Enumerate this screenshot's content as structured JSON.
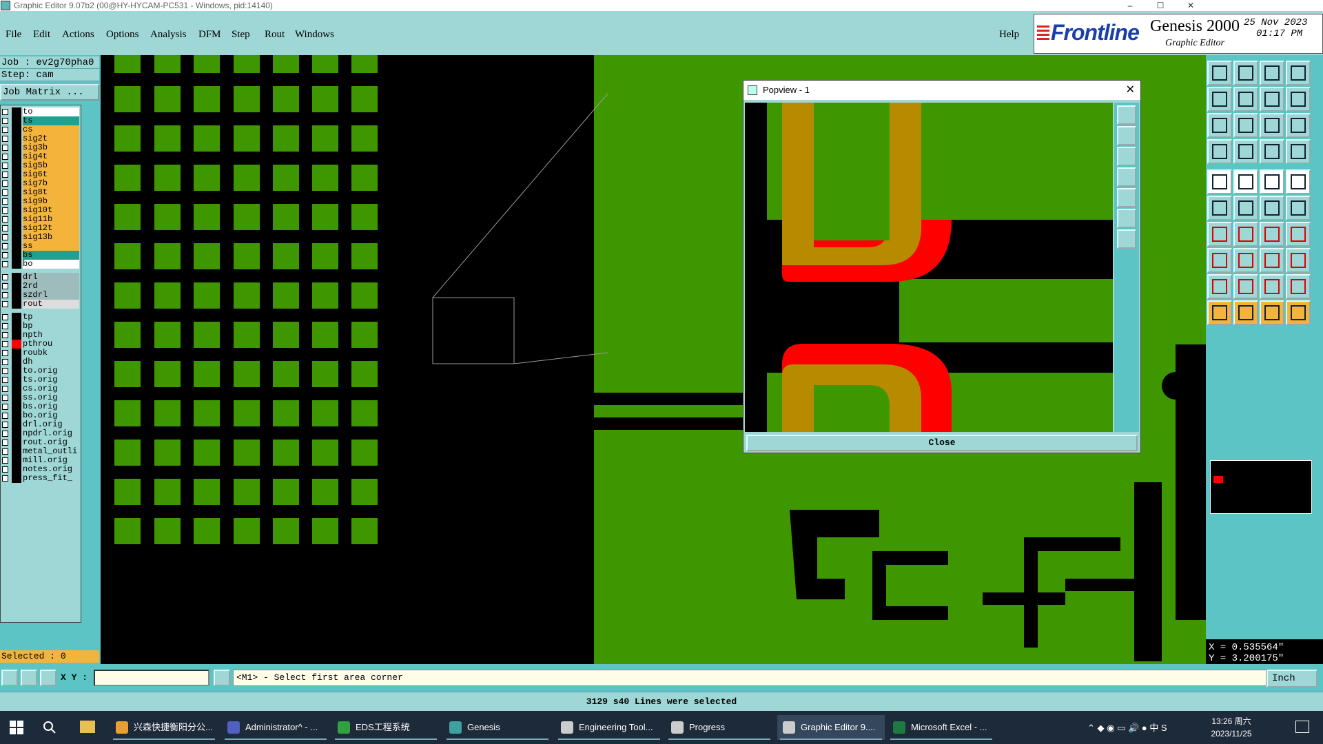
{
  "window": {
    "title": "Graphic Editor 9.07b2 (00@HY-HYCAM-PC531 - Windows, pid:14140)",
    "controls": [
      "–",
      "☐",
      "✕"
    ]
  },
  "menu": {
    "items": [
      "File",
      "Edit",
      "Actions",
      "Options",
      "Analysis",
      "DFM",
      "Step",
      "Rout",
      "Windows"
    ],
    "help": "Help"
  },
  "logo": {
    "brand": "Frontline",
    "product": "Genesis 2000",
    "subtitle": "Graphic Editor",
    "date": "25 Nov 2023",
    "time": "01:17 PM"
  },
  "job": {
    "job_line": "Job : ev2g70pha0",
    "step_line": "Step: cam",
    "matrix_button": "Job Matrix ...",
    "selected": "Selected : 0"
  },
  "layers": [
    {
      "name": "to",
      "color": "#ffffff"
    },
    {
      "name": "ts",
      "color": "#20a090"
    },
    {
      "name": "cs",
      "color": "#f4b43c"
    },
    {
      "name": "sig2t",
      "color": "#f4b43c"
    },
    {
      "name": "sig3b",
      "color": "#f4b43c"
    },
    {
      "name": "sig4t",
      "color": "#f4b43c"
    },
    {
      "name": "sig5b",
      "color": "#f4b43c"
    },
    {
      "name": "sig6t",
      "color": "#f4b43c"
    },
    {
      "name": "sig7b",
      "color": "#f4b43c"
    },
    {
      "name": "sig8t",
      "color": "#f4b43c"
    },
    {
      "name": "sig9b",
      "color": "#f4b43c"
    },
    {
      "name": "sig10t",
      "color": "#f4b43c"
    },
    {
      "name": "sig11b",
      "color": "#f4b43c"
    },
    {
      "name": "sig12t",
      "color": "#f4b43c"
    },
    {
      "name": "sig13b",
      "color": "#f4b43c"
    },
    {
      "name": "ss",
      "color": "#f4b43c"
    },
    {
      "name": "bs",
      "color": "#20a090"
    },
    {
      "name": "bo",
      "color": "#ffffff"
    },
    {
      "name": "drl",
      "color": "#9fbcbc"
    },
    {
      "name": "2rd",
      "color": "#9fbcbc"
    },
    {
      "name": "szdrl",
      "color": "#9fbcbc"
    },
    {
      "name": "rout",
      "color": "#dddddd"
    },
    {
      "name": "tp",
      "color": "#9fd6d6"
    },
    {
      "name": "bp",
      "color": "#9fd6d6"
    },
    {
      "name": "npth",
      "color": "#9fd6d6"
    },
    {
      "name": "pthrou",
      "color": "#9fd6d6"
    },
    {
      "name": "roubk",
      "color": "#9fd6d6"
    },
    {
      "name": "dh",
      "color": "#9fd6d6"
    },
    {
      "name": "to.orig",
      "color": "#9fd6d6"
    },
    {
      "name": "ts.orig",
      "color": "#9fd6d6"
    },
    {
      "name": "cs.orig",
      "color": "#9fd6d6"
    },
    {
      "name": "ss.orig",
      "color": "#9fd6d6"
    },
    {
      "name": "bs.orig",
      "color": "#9fd6d6"
    },
    {
      "name": "bo.orig",
      "color": "#9fd6d6"
    },
    {
      "name": "drl.orig",
      "color": "#9fd6d6"
    },
    {
      "name": "npdrl.orig",
      "color": "#9fd6d6"
    },
    {
      "name": "rout.orig",
      "color": "#9fd6d6"
    },
    {
      "name": "metal_outli",
      "color": "#9fd6d6"
    },
    {
      "name": "mill.orig",
      "color": "#9fd6d6"
    },
    {
      "name": "notes.orig",
      "color": "#9fd6d6"
    },
    {
      "name": "press_fit_",
      "color": "#9fd6d6"
    }
  ],
  "popview": {
    "title": "Popview - 1",
    "close_x": "✕",
    "close_button": "Close"
  },
  "coords": {
    "x": "X = 0.535564\"",
    "y": "Y = 3.200175\""
  },
  "command": {
    "xy_label": "X Y :",
    "xy_value": "",
    "prompt": "<M1> - Select first area corner",
    "units": "Inch"
  },
  "status": {
    "message": "3129 s40 Lines were selected"
  },
  "taskbar": {
    "items": [
      {
        "label": "兴森快捷衡阳分公...",
        "icon_color": "#e8a030",
        "active": false
      },
      {
        "label": "Administrator^ - ...",
        "icon_color": "#5060c0",
        "active": false
      },
      {
        "label": "EDS工程系统",
        "icon_color": "#30a040",
        "active": false
      },
      {
        "label": "Genesis",
        "icon_color": "#40a0a0",
        "active": false
      },
      {
        "label": "Engineering Tool...",
        "icon_color": "#cccccc",
        "active": false
      },
      {
        "label": "Progress",
        "icon_color": "#cccccc",
        "active": false
      },
      {
        "label": "Graphic Editor 9....",
        "icon_color": "#cccccc",
        "active": true
      },
      {
        "label": "Microsoft Excel - ...",
        "icon_color": "#1e7a40",
        "active": false
      }
    ],
    "time": "13:26 周六",
    "date": "2023/11/25"
  },
  "colors": {
    "panel": "#9fd6d6",
    "panel_dark": "#5cc4c4",
    "copper_green": "#3f9700",
    "highlight_red": "#ff0000",
    "pad_gold": "#b88a00"
  }
}
